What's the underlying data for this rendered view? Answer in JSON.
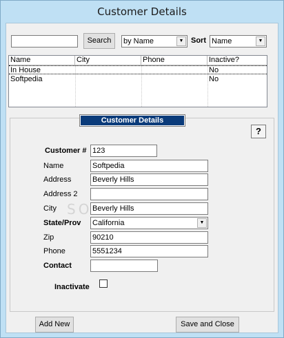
{
  "window": {
    "title": "Customer Details"
  },
  "search": {
    "value": "",
    "button_label": "Search",
    "filter_value": "by Name",
    "sort_label": "Sort",
    "sort_value": "Name"
  },
  "list": {
    "columns": [
      "Name",
      "City",
      "Phone",
      "Inactive?"
    ],
    "rows": [
      {
        "name": "In House",
        "city": "",
        "phone": "",
        "inactive": "No"
      },
      {
        "name": "Softpedia",
        "city": "",
        "phone": "",
        "inactive": "No"
      }
    ]
  },
  "details": {
    "title": "Customer Details",
    "help_label": "?",
    "customer_no_label": "Customer #",
    "customer_no": "123",
    "name_label": "Name",
    "name": "Softpedia",
    "address_label": "Address",
    "address": "Beverly Hills",
    "address2_label": "Address 2",
    "address2": "",
    "city_label": "City",
    "city": "Beverly Hills",
    "state_label": "State/Prov",
    "state": "California",
    "zip_label": "Zip",
    "zip": "90210",
    "phone_label": "Phone",
    "phone": "5551234",
    "contact_label": "Contact",
    "contact": "",
    "inactivate_label": "Inactivate",
    "inactivate_checked": false
  },
  "footer": {
    "add_new_label": "Add New",
    "save_close_label": "Save and Close"
  },
  "colors": {
    "panel_title_bg": "#0a3b7a",
    "window_frame": "#bfe0f4"
  }
}
